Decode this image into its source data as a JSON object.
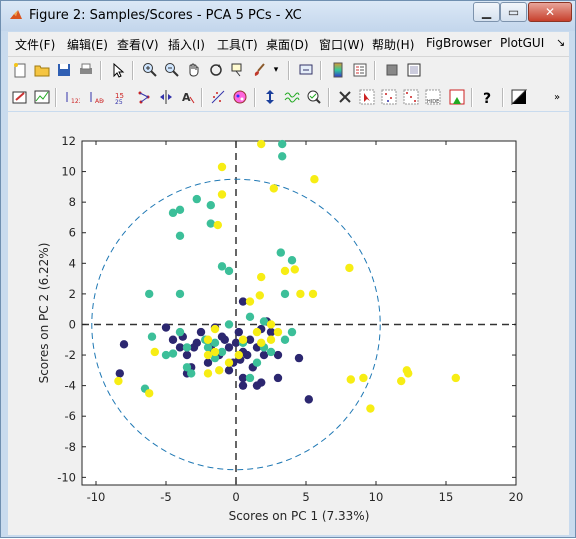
{
  "window": {
    "title": "Figure 2: Samples/Scores - PCA 5 PCs - XC"
  },
  "menu": [
    "文件(F)",
    "编辑(E)",
    "查看(V)",
    "插入(I)",
    "工具(T)",
    "桌面(D)",
    "窗口(W)",
    "帮助(H)",
    "FigBrowser",
    "PlotGUI"
  ],
  "toolbar1": [
    "new-figure",
    "open-file",
    "save",
    "print",
    "select-arrow",
    "zoom-in",
    "zoom-out",
    "pan",
    "rotate",
    "data-cursor",
    "brush",
    "link-plot",
    "colorbar",
    "legend",
    "hide-plot-tools",
    "show-plot-tools"
  ],
  "toolbar2": [
    "edit-plot",
    "chart-line",
    "sort-123",
    "sort-abc",
    "sort-15",
    "connect-points",
    "split",
    "label-text",
    "scatter-points",
    "color-groups",
    "vertical-move",
    "waveform",
    "zoom-check",
    "wrench-scissors",
    "select-pointer",
    "select-box",
    "select-grid",
    "hide",
    "legend-arrow",
    "help",
    "contrast"
  ],
  "colors": {
    "cluster_a": "#2c2770",
    "cluster_b": "#3cbf99",
    "cluster_c": "#f7ed14",
    "ellipse": "#1f78b4"
  },
  "chart_data": {
    "type": "scatter",
    "title": "",
    "xlabel": "Scores on PC 1 (7.33%)",
    "ylabel": "Scores on PC 2 (6.22%)",
    "xlim": [
      -11,
      20
    ],
    "ylim": [
      -10.5,
      12
    ],
    "xticks": [
      -10,
      -5,
      0,
      5,
      10,
      15,
      20
    ],
    "yticks": [
      -10,
      -8,
      -6,
      -4,
      -2,
      0,
      2,
      4,
      6,
      8,
      10,
      12
    ],
    "grid": false,
    "confidence_ellipse": {
      "cx": 0,
      "cy": 0,
      "rx": 10.3,
      "ry": 9.5
    },
    "reference_lines": {
      "x": 0,
      "y": 0
    },
    "series": [
      {
        "color": "#2c2770",
        "points": [
          [
            -8,
            -1.3
          ],
          [
            -8.3,
            -3.2
          ],
          [
            -5,
            -0.2
          ],
          [
            -4.5,
            -1
          ],
          [
            -4,
            -1.5
          ],
          [
            -3.8,
            -0.8
          ],
          [
            -3.5,
            -2
          ],
          [
            -3.2,
            -2.8
          ],
          [
            -3.5,
            -3.2
          ],
          [
            -2.8,
            -1.2
          ],
          [
            -2.5,
            -0.5
          ],
          [
            -2,
            -2.5
          ],
          [
            -1.8,
            -1.5
          ],
          [
            -1.5,
            -0.2
          ],
          [
            -1.2,
            -2
          ],
          [
            -0.8,
            -1
          ],
          [
            -0.5,
            -1.5
          ],
          [
            -0.5,
            -3
          ],
          [
            -0.2,
            -2.5
          ],
          [
            0,
            -1.2
          ],
          [
            0.2,
            -0.5
          ],
          [
            0.5,
            -1.8
          ],
          [
            0.5,
            -3.5
          ],
          [
            0.8,
            -2
          ],
          [
            1,
            -1
          ],
          [
            1.2,
            -2.8
          ],
          [
            1.5,
            -1.5
          ],
          [
            1.8,
            -3.8
          ],
          [
            2,
            -2
          ],
          [
            2.5,
            -0.5
          ],
          [
            1.8,
            -0.3
          ],
          [
            0.5,
            1.5
          ],
          [
            0.5,
            -4
          ],
          [
            1.5,
            -4
          ],
          [
            5.2,
            -4.9
          ],
          [
            3,
            -3.5
          ],
          [
            3,
            -2
          ],
          [
            4.5,
            -2.2
          ],
          [
            -3,
            -1.5
          ],
          [
            0.3,
            -2.3
          ],
          [
            -1,
            -0.8
          ],
          [
            2.2,
            0.2
          ]
        ]
      },
      {
        "color": "#3cbf99",
        "points": [
          [
            -6.2,
            2
          ],
          [
            -4.5,
            7.3
          ],
          [
            -4,
            7.5
          ],
          [
            -4,
            5.8
          ],
          [
            -3.5,
            -1.5
          ],
          [
            -3.5,
            -2.8
          ],
          [
            -3.2,
            -3.2
          ],
          [
            -2.8,
            8.2
          ],
          [
            -1.8,
            7.8
          ],
          [
            -1.8,
            6.6
          ],
          [
            -4,
            2
          ],
          [
            -4,
            -0.5
          ],
          [
            -4.5,
            -1.9
          ],
          [
            -2.2,
            -1
          ],
          [
            -2,
            -1.5
          ],
          [
            -1.5,
            -1.2
          ],
          [
            -1,
            -1.8
          ],
          [
            -0.5,
            0
          ],
          [
            -0.5,
            3.5
          ],
          [
            -1,
            3.8
          ],
          [
            3.3,
            11.8
          ],
          [
            3.3,
            11
          ],
          [
            3.2,
            4.7
          ],
          [
            4,
            4.2
          ],
          [
            3.5,
            2
          ],
          [
            2,
            -1.5
          ],
          [
            1.5,
            -2.5
          ],
          [
            1,
            -3.5
          ],
          [
            3.5,
            -1
          ],
          [
            2.5,
            -1.8
          ],
          [
            -6.5,
            -4.2
          ],
          [
            -5,
            -2
          ],
          [
            -6,
            -0.8
          ],
          [
            -1.5,
            -2.2
          ],
          [
            0.5,
            -1.2
          ],
          [
            1,
            0.5
          ],
          [
            2,
            0.2
          ],
          [
            4,
            -0.5
          ]
        ]
      },
      {
        "color": "#f7ed14",
        "points": [
          [
            -1,
            10.3
          ],
          [
            -1,
            8.5
          ],
          [
            -1.3,
            6.5
          ],
          [
            1.8,
            11.8
          ],
          [
            2.7,
            8.9
          ],
          [
            5.6,
            9.5
          ],
          [
            1.8,
            3.1
          ],
          [
            3.5,
            3.5
          ],
          [
            4.2,
            3.6
          ],
          [
            4.6,
            2
          ],
          [
            5.5,
            2
          ],
          [
            3,
            -0.5
          ],
          [
            1.7,
            1.9
          ],
          [
            1.5,
            -0.5
          ],
          [
            1,
            1.5
          ],
          [
            0.5,
            -1
          ],
          [
            -1.5,
            -0.3
          ],
          [
            -1.5,
            -1.8
          ],
          [
            -2,
            -1
          ],
          [
            -1.2,
            -3
          ],
          [
            -0.5,
            -2.5
          ],
          [
            0.2,
            -2
          ],
          [
            -2,
            -3.2
          ],
          [
            -5.8,
            -1.8
          ],
          [
            -8.4,
            -3.7
          ],
          [
            -6.2,
            -4.5
          ],
          [
            8.1,
            3.7
          ],
          [
            8.2,
            -3.6
          ],
          [
            9.1,
            -3.5
          ],
          [
            9.6,
            -5.5
          ],
          [
            11.8,
            -3.7
          ],
          [
            12.2,
            -3
          ],
          [
            12.3,
            -3.2
          ],
          [
            15.7,
            -3.5
          ],
          [
            2.5,
            0
          ],
          [
            2.5,
            -1
          ],
          [
            1.8,
            -1.2
          ],
          [
            -2,
            -2
          ]
        ]
      }
    ]
  }
}
